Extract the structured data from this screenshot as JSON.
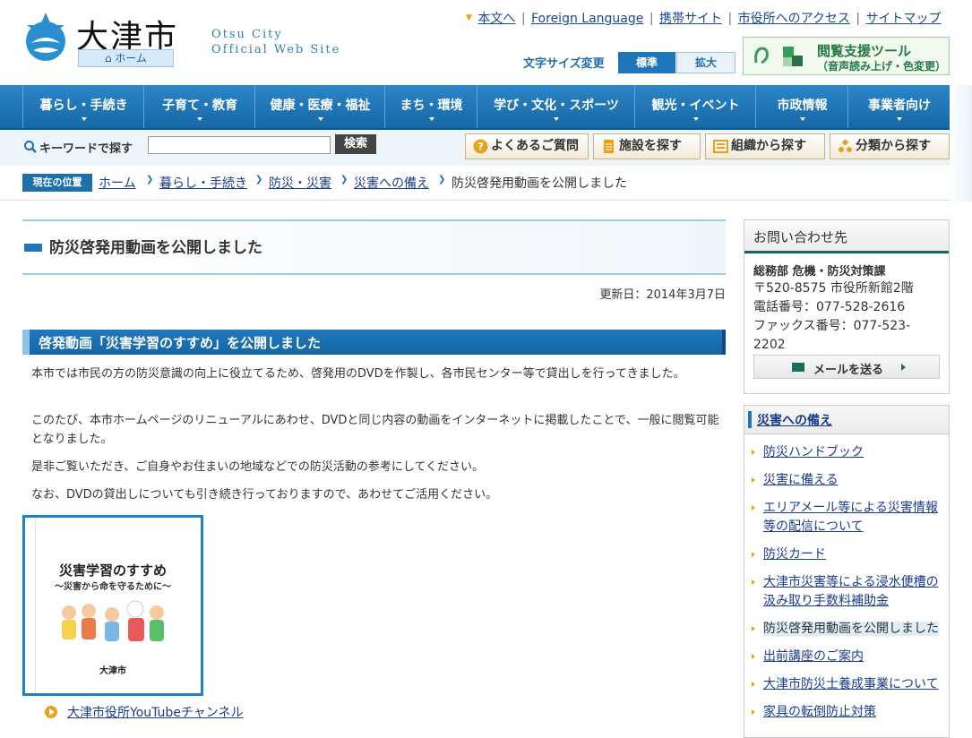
{
  "header": {
    "logo_title": "大津市",
    "home_badge": "ホーム",
    "site_en_line1": "Otsu City",
    "site_en_line2": "Official Web Site",
    "top_links": [
      "本文へ",
      "Foreign Language",
      "携帯サイト",
      "市役所へのアクセス",
      "サイトマップ"
    ],
    "font_size_label": "文字サイズ変更",
    "font_std": "標準",
    "font_large": "拡大",
    "assist_title": "閲覧支援ツール",
    "assist_sub": "（音声読み上げ・色変更）"
  },
  "nav": [
    "暮らし・手続き",
    "子育て・教育",
    "健康・医療・福祉",
    "まち・環境",
    "学び・文化・スポーツ",
    "観光・イベント",
    "市政情報",
    "事業者向け"
  ],
  "search": {
    "label": "キーワードで探す",
    "value": "",
    "button": "検索",
    "quick_buttons": [
      "よくあるご質問",
      "施設を探す",
      "組織から探す",
      "分類から探す"
    ]
  },
  "breadcrumb": {
    "here_label": "現在の位置",
    "items": [
      "ホーム",
      "暮らし・手続き",
      "防災・災害",
      "災害への備え"
    ],
    "current": "防災啓発用動画を公開しました"
  },
  "main": {
    "title": "防災啓発用動画を公開しました",
    "updated": "更新日：2014年3月7日",
    "section_title": "啓発動画「災害学習のすすめ」を公開しました",
    "paragraphs": [
      "本市では市民の方の防災意識の向上に役立てるため、啓発用のDVDを作製し、各市民センター等で貸出しを行ってきました。",
      "このたび、本市ホームページのリニューアルにあわせ、DVDと同じ内容の動画をインターネットに掲載したことで、一般に閲覧可能となりました。",
      "是非ご覧いただき、ご自身やお住まいの地域などでの防災活動の参考にしてください。",
      "なお、DVDの貸出しについても引き続き行っておりますので、あわせてご活用ください。"
    ],
    "dvd_title": "災害学習のすすめ",
    "dvd_subtitle": "〜災害から命を守るために〜",
    "dvd_city": "大津市",
    "youtube_link": "大津市役所YouTubeチャンネル"
  },
  "contact": {
    "heading": "お問い合わせ先",
    "dept": "総務部 危機・防災対策課",
    "address": "〒520-8575 市役所新館2階",
    "tel": "電話番号：077-528-2616",
    "fax": "ファックス番号：077-523-2202",
    "mail_button": "メールを送る"
  },
  "related": {
    "heading": "災害への備え",
    "items": [
      "防災ハンドブック",
      "災害に備える",
      "エリアメール等による災害情報等の配信について",
      "防災カード",
      "大津市災害等による浸水便槽の汲み取り手数料補助金",
      "防災啓発用動画を公開しました",
      "出前講座のご案内",
      "大津市防災士養成事業について",
      "家具の転倒防止対策"
    ]
  }
}
